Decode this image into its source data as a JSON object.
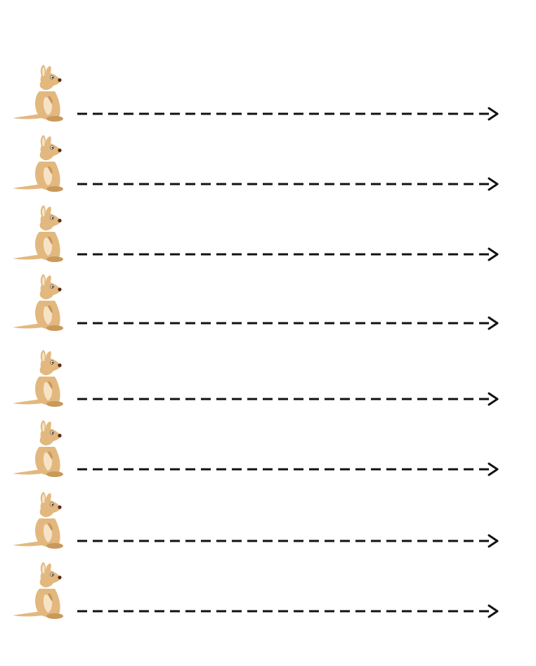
{
  "worksheet": {
    "rows": [
      {
        "icon": "kangaroo-icon"
      },
      {
        "icon": "kangaroo-icon"
      },
      {
        "icon": "kangaroo-icon"
      },
      {
        "icon": "kangaroo-icon"
      },
      {
        "icon": "kangaroo-icon"
      },
      {
        "icon": "kangaroo-icon"
      },
      {
        "icon": "kangaroo-icon"
      },
      {
        "icon": "kangaroo-icon"
      }
    ],
    "colors": {
      "fur": "#e3b87e",
      "fur_dark": "#c9995c",
      "belly": "#f6e3c6",
      "nose": "#5a2d1a",
      "line": "#111111",
      "background": "#ffffff"
    }
  }
}
